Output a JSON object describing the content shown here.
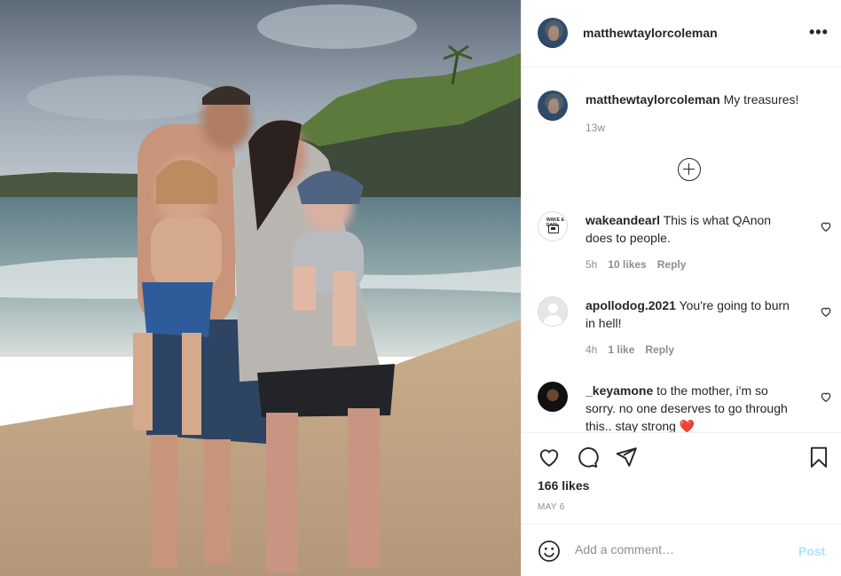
{
  "post": {
    "owner_username": "matthewtaylorcoleman",
    "caption_text": "My treasures!",
    "caption_time": "13w",
    "likes": "166 likes",
    "date": "MAY 6"
  },
  "comments": [
    {
      "username": "wakeandearl",
      "text": "This is what QAnon does to people.",
      "time": "5h",
      "likes": "10 likes",
      "reply": "Reply",
      "avatar_text": "WAKE & EARL"
    },
    {
      "username": "apollodog.2021",
      "text": "You're going to burn in hell!",
      "time": "4h",
      "likes": "1 like",
      "reply": "Reply"
    },
    {
      "username": "_keyamone",
      "text": "to the mother, i'm so sorry. no one deserves to go through this.. stay strong ❤️",
      "time": "",
      "likes": "",
      "reply": ""
    }
  ],
  "add_comment": {
    "placeholder": "Add a comment…",
    "post_label": "Post"
  },
  "icons": [
    "more-icon",
    "load-more-icon",
    "heart-icon",
    "comment-icon",
    "share-icon",
    "bookmark-icon",
    "emoji-icon"
  ],
  "colors": {
    "text": "#262626",
    "secondary": "#8e8e8e",
    "divider": "#efefef",
    "post_disabled": "#b2dffc"
  }
}
